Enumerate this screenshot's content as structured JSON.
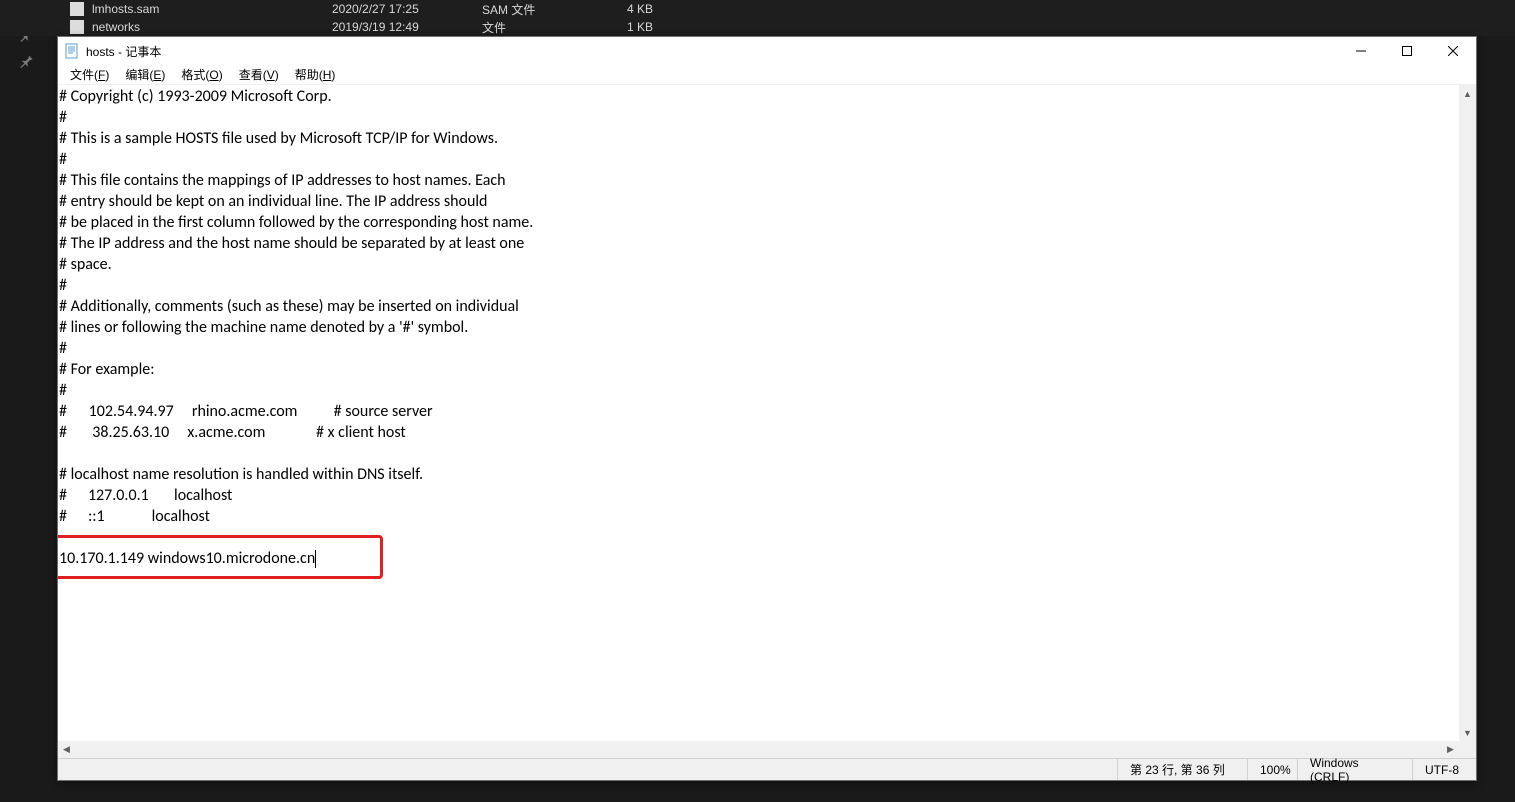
{
  "explorer": {
    "rows": [
      {
        "name": "lmhosts.sam",
        "date": "2020/2/27 17:25",
        "type": "SAM 文件",
        "size": "4 KB"
      },
      {
        "name": "networks",
        "date": "2019/3/19 12:49",
        "type": "文件",
        "size": "1 KB"
      }
    ]
  },
  "notepad": {
    "title": "hosts - 记事本",
    "menus": {
      "file": "文件(F)",
      "edit": "编辑(E)",
      "format": "格式(O)",
      "view": "查看(V)",
      "help": "帮助(H)"
    },
    "content_lines": [
      "# Copyright (c) 1993-2009 Microsoft Corp.",
      "#",
      "# This is a sample HOSTS file used by Microsoft TCP/IP for Windows.",
      "#",
      "# This file contains the mappings of IP addresses to host names. Each",
      "# entry should be kept on an individual line. The IP address should",
      "# be placed in the first column followed by the corresponding host name.",
      "# The IP address and the host name should be separated by at least one",
      "# space.",
      "#",
      "# Additionally, comments (such as these) may be inserted on individual",
      "# lines or following the machine name denoted by a '#' symbol.",
      "#",
      "# For example:",
      "#",
      "#      102.54.94.97     rhino.acme.com          # source server",
      "#       38.25.63.10     x.acme.com              # x client host",
      "",
      "# localhost name resolution is handled within DNS itself.",
      "#\t127.0.0.1       localhost",
      "#\t::1             localhost",
      "",
      "10.170.1.149 windows10.microdone.cn"
    ],
    "status": {
      "position": "第 23 行, 第 36 列",
      "zoom": "100%",
      "eol": "Windows (CRLF)",
      "encoding": "UTF-8"
    }
  }
}
